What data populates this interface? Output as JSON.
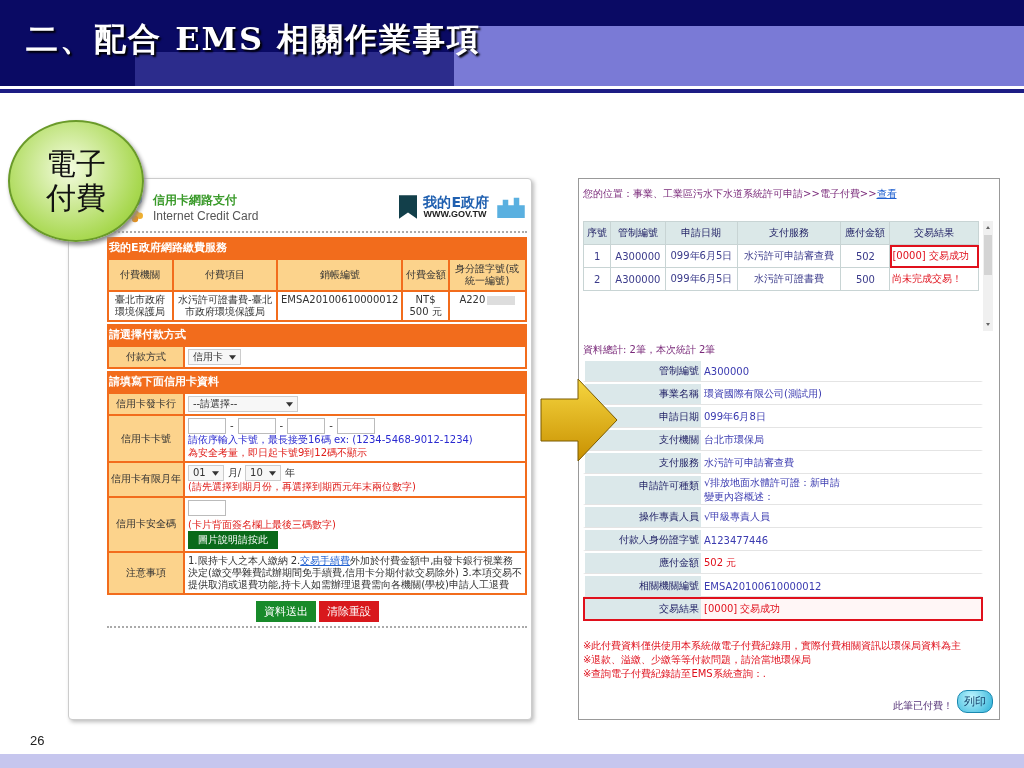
{
  "slide": {
    "title": "二、配合 EMS 相關作業事項",
    "badge": "電子付費",
    "page_number": "26"
  },
  "payment_page": {
    "brand": {
      "title": "信用卡網路支付",
      "subtitle": "Internet Credit Card",
      "portal_name": "我的E政府",
      "portal_url": "WWW.GOV.TW"
    },
    "service": {
      "heading": "我的E政府網路繳費服務",
      "columns": [
        "付費機關",
        "付費項目",
        "銷帳編號",
        "付費金額",
        "身分證字號(或統一編號)"
      ],
      "row": [
        "臺北市政府環境保護局",
        "水污許可證書費-臺北市政府環境保護局",
        "EMSA20100610000012",
        "NT$ 500 元",
        "A220"
      ]
    },
    "method": {
      "heading": "請選擇付款方式",
      "label": "付款方式",
      "value": "信用卡"
    },
    "card": {
      "heading": "請填寫下面信用卡資料",
      "bank_label": "信用卡發卡行",
      "bank_value": "--請選擇--",
      "number_label": "信用卡卡號",
      "number_separators": [
        "-",
        "-",
        "-"
      ],
      "number_hint": "請依序輸入卡號，最長接受16碼 ex: (1234-5468-9012-1234)",
      "number_warning": "為安全考量，即日起卡號9到12碼不顯示",
      "expiry_label": "信用卡有限月年",
      "month": "01",
      "month_unit": "月/",
      "year": "10",
      "year_unit": "年",
      "expiry_hint": "(請先選擇到期月份，再選擇到期西元年末兩位數字)",
      "cvv_label": "信用卡安全碼",
      "cvv_hint": "(卡片背面簽名欄上最後三碼數字)",
      "cvv_button": "圖片說明請按此",
      "notes_label": "注意事項",
      "notes_before": "1.限持卡人之本人繳納 2.",
      "notes_link": "交易手續費",
      "notes_after": "外加於付費金額中,由發卡銀行視業務決定(繳交學雜費試辦期間免手續費,信用卡分期付款交易除外) 3.本項交易不提供取消或退費功能,持卡人如需辦理退費需向各機關(學校)申請人工退費"
    },
    "buttons": [
      {
        "label": "資料送出",
        "kind": "submit"
      },
      {
        "label": "清除重設",
        "kind": "reset"
      }
    ]
  },
  "records_page": {
    "breadcrumb": "您的位置：事業、工業區污水下水道系統許可申請>>電子付費>>",
    "breadcrumb_link": "查看",
    "table": {
      "columns": [
        "序號",
        "管制編號",
        "申請日期",
        "支付服務",
        "應付金額",
        "交易結果"
      ],
      "rows": [
        {
          "cells": [
            "1",
            "A300000",
            "099年6月5日",
            "水污許可申請審查費",
            "502"
          ],
          "result": "[0000] 交易成功",
          "highlighted": true
        },
        {
          "cells": [
            "2",
            "A300000",
            "099年6月5日",
            "水污許可證書費",
            "500"
          ],
          "result": "尚未完成交易！",
          "highlighted": false
        }
      ]
    },
    "summary": "資料總計: 2筆，本次統計 2筆",
    "details": [
      {
        "label": "管制編號",
        "lines": [
          "A300000"
        ],
        "alert": false,
        "highlighted": false
      },
      {
        "label": "事業名稱",
        "lines": [
          "環資國際有限公司(測試用)"
        ],
        "alert": false,
        "highlighted": false
      },
      {
        "label": "申請日期",
        "lines": [
          "099年6月8日"
        ],
        "alert": false,
        "highlighted": false
      },
      {
        "label": "支付機關",
        "lines": [
          "台北市環保局"
        ],
        "alert": false,
        "highlighted": false
      },
      {
        "label": "支付服務",
        "lines": [
          "水污許可申請審查費"
        ],
        "alert": false,
        "highlighted": false
      },
      {
        "label": "申請許可種類",
        "lines": [
          "√排放地面水體許可證：新申請",
          "變更內容概述："
        ],
        "alert": false,
        "highlighted": false
      },
      {
        "label": "操作專責人員",
        "lines": [
          "√甲級專責人員"
        ],
        "alert": false,
        "highlighted": false
      },
      {
        "label": "付款人身份證字號",
        "lines": [
          "A123477446"
        ],
        "alert": false,
        "highlighted": false
      },
      {
        "label": "應付金額",
        "lines": [
          "502 元"
        ],
        "alert": true,
        "highlighted": false
      },
      {
        "label": "相關機關編號",
        "lines": [
          "EMSA20100610000012"
        ],
        "alert": false,
        "highlighted": false
      },
      {
        "label": "交易結果",
        "lines": [
          "[0000] 交易成功"
        ],
        "alert": true,
        "highlighted": true
      }
    ],
    "notices": [
      "※此付費資料僅供使用本系統做電子付費紀錄用，實際付費相關資訊以環保局資料為主",
      "※退款、溢繳、少繳等等付款問題，請洽當地環保局",
      "※查詢電子付費紀錄請至EMS系統查詢：."
    ],
    "footer_note": "此筆已付費！",
    "print_button": "列印"
  }
}
